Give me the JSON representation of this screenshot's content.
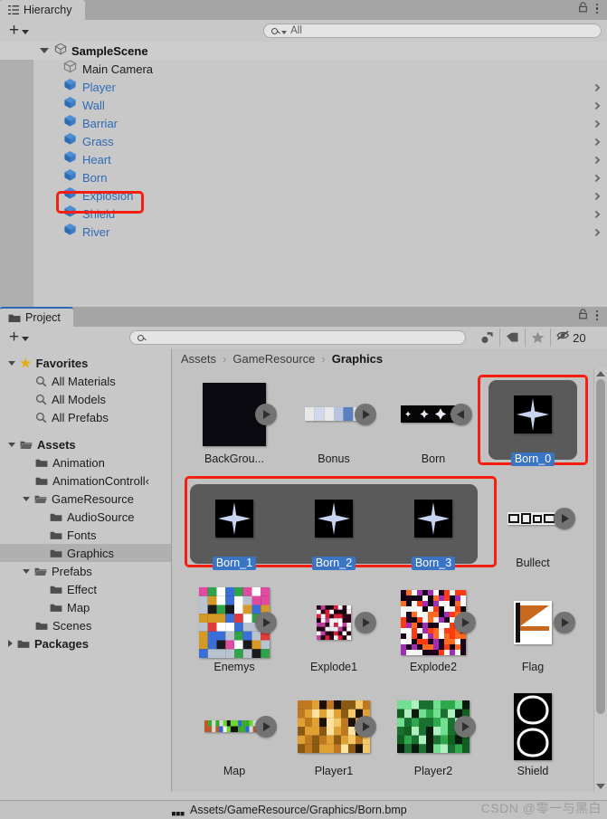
{
  "hierarchy": {
    "tab_label": "Hierarchy",
    "tab_icon": "hierarchy-icon",
    "lock_icon": "lock-icon",
    "menu_icon": "kebab-menu-icon",
    "add_label": "+",
    "search_placeholder": "All",
    "search_value": "",
    "scene_name": "SampleScene",
    "objects": [
      {
        "name": "Main Camera",
        "type": "camera",
        "expandable": false,
        "highlighted": false
      },
      {
        "name": "Player",
        "type": "prefab",
        "expandable": true,
        "highlighted": false
      },
      {
        "name": "Wall",
        "type": "prefab",
        "expandable": true,
        "highlighted": false
      },
      {
        "name": "Barriar",
        "type": "prefab",
        "expandable": true,
        "highlighted": false
      },
      {
        "name": "Grass",
        "type": "prefab",
        "expandable": true,
        "highlighted": false
      },
      {
        "name": "Heart",
        "type": "prefab",
        "expandable": true,
        "highlighted": false
      },
      {
        "name": "Born",
        "type": "prefab",
        "expandable": true,
        "highlighted": true
      },
      {
        "name": "Explosion",
        "type": "prefab",
        "expandable": true,
        "highlighted": false
      },
      {
        "name": "Shield",
        "type": "prefab",
        "expandable": true,
        "highlighted": false
      },
      {
        "name": "River",
        "type": "prefab",
        "expandable": true,
        "highlighted": false
      }
    ]
  },
  "project": {
    "tab_label": "Project",
    "tab_icon": "folder-icon",
    "lock_icon": "lock-icon",
    "menu_icon": "kebab-menu-icon",
    "add_label": "+",
    "search_placeholder": "",
    "search_value": "",
    "toolbar_icons": [
      {
        "name": "type-filter-icon",
        "label": ""
      },
      {
        "name": "label-filter-icon",
        "label": ""
      },
      {
        "name": "favorite-filter-icon",
        "label": ""
      },
      {
        "name": "hidden-packages-icon",
        "label": "20"
      }
    ],
    "tree": [
      {
        "label": "Favorites",
        "indent": 0,
        "arrow": "open",
        "icon": "star-icon",
        "bold": true,
        "selected": false
      },
      {
        "label": "All Materials",
        "indent": 1,
        "arrow": "none",
        "icon": "search-icon",
        "bold": false,
        "selected": false
      },
      {
        "label": "All Models",
        "indent": 1,
        "arrow": "none",
        "icon": "search-icon",
        "bold": false,
        "selected": false
      },
      {
        "label": "All Prefabs",
        "indent": 1,
        "arrow": "none",
        "icon": "search-icon",
        "bold": false,
        "selected": false
      },
      {
        "label": "",
        "indent": 0,
        "arrow": "none",
        "icon": "spacer",
        "bold": false,
        "selected": false
      },
      {
        "label": "Assets",
        "indent": 0,
        "arrow": "open",
        "icon": "folder-open-icon",
        "bold": true,
        "selected": false
      },
      {
        "label": "Animation",
        "indent": 1,
        "arrow": "none",
        "icon": "folder-icon",
        "bold": false,
        "selected": false
      },
      {
        "label": "AnimationControll‹",
        "indent": 1,
        "arrow": "none",
        "icon": "folder-icon",
        "bold": false,
        "selected": false
      },
      {
        "label": "GameResource",
        "indent": 1,
        "arrow": "open",
        "icon": "folder-open-icon",
        "bold": false,
        "selected": false
      },
      {
        "label": "AudioSource",
        "indent": 2,
        "arrow": "none",
        "icon": "folder-icon",
        "bold": false,
        "selected": false
      },
      {
        "label": "Fonts",
        "indent": 2,
        "arrow": "none",
        "icon": "folder-icon",
        "bold": false,
        "selected": false
      },
      {
        "label": "Graphics",
        "indent": 2,
        "arrow": "none",
        "icon": "folder-icon",
        "bold": false,
        "selected": true
      },
      {
        "label": "Prefabs",
        "indent": 1,
        "arrow": "open",
        "icon": "folder-open-icon",
        "bold": false,
        "selected": false
      },
      {
        "label": "Effect",
        "indent": 2,
        "arrow": "none",
        "icon": "folder-icon",
        "bold": false,
        "selected": false
      },
      {
        "label": "Map",
        "indent": 2,
        "arrow": "none",
        "icon": "folder-icon",
        "bold": false,
        "selected": false
      },
      {
        "label": "Scenes",
        "indent": 1,
        "arrow": "none",
        "icon": "folder-icon",
        "bold": false,
        "selected": false
      },
      {
        "label": "Packages",
        "indent": 0,
        "arrow": "closed",
        "icon": "folder-icon",
        "bold": true,
        "selected": false
      }
    ],
    "breadcrumb": [
      "Assets",
      "GameResource",
      "Graphics"
    ],
    "assets": [
      [
        {
          "name": "BackGrou...",
          "thumb": "background-black",
          "expandable": true,
          "selected": false,
          "arrow_side": "right"
        },
        {
          "name": "Bonus",
          "thumb": "bonus-strip",
          "expandable": true,
          "selected": false,
          "arrow_side": "right"
        },
        {
          "name": "Born",
          "thumb": "born-strip",
          "expandable": true,
          "selected": false,
          "arrow_side": "left"
        },
        {
          "name": "Born_0",
          "thumb": "star-sprite",
          "expandable": false,
          "selected": true,
          "arrow_side": "none"
        }
      ],
      [
        {
          "name": "Born_1",
          "thumb": "star-sprite",
          "expandable": false,
          "selected": true,
          "arrow_side": "none"
        },
        {
          "name": "Born_2",
          "thumb": "star-sprite",
          "expandable": false,
          "selected": true,
          "arrow_side": "none"
        },
        {
          "name": "Born_3",
          "thumb": "star-sprite",
          "expandable": false,
          "selected": true,
          "arrow_side": "none"
        },
        {
          "name": "Bullect",
          "thumb": "bullet-strip",
          "expandable": true,
          "selected": false,
          "arrow_side": "right"
        }
      ],
      [
        {
          "name": "Enemys",
          "thumb": "enemys-sheet",
          "expandable": true,
          "selected": false,
          "arrow_side": "right"
        },
        {
          "name": "Explode1",
          "thumb": "explode1",
          "expandable": true,
          "selected": false,
          "arrow_side": "right"
        },
        {
          "name": "Explode2",
          "thumb": "explode2",
          "expandable": true,
          "selected": false,
          "arrow_side": "right"
        },
        {
          "name": "Flag",
          "thumb": "flag",
          "expandable": true,
          "selected": false,
          "arrow_side": "right"
        }
      ],
      [
        {
          "name": "Map",
          "thumb": "map-strip",
          "expandable": true,
          "selected": false,
          "arrow_side": "right"
        },
        {
          "name": "Player1",
          "thumb": "player1-sheet",
          "expandable": true,
          "selected": false,
          "arrow_side": "right"
        },
        {
          "name": "Player2",
          "thumb": "player2-sheet",
          "expandable": true,
          "selected": false,
          "arrow_side": "right"
        },
        {
          "name": "Shield",
          "thumb": "shield-sheet",
          "expandable": true,
          "selected": false,
          "arrow_side": "none"
        }
      ]
    ],
    "status_path": "Assets/GameResource/Graphics/Born.bmp",
    "status_icon": "bmp-file-icon"
  },
  "watermark": "CSDN @零一与黑白",
  "colors": {
    "highlight_red": "#f51e10",
    "selection_blue": "#3a74c4",
    "link_blue": "#2f6ab5",
    "panel_bg": "#c8c8c8",
    "content_bg": "#c2c2c2",
    "tabbar_bg": "#a5a5a5",
    "focus_border": "#2c68b5"
  }
}
